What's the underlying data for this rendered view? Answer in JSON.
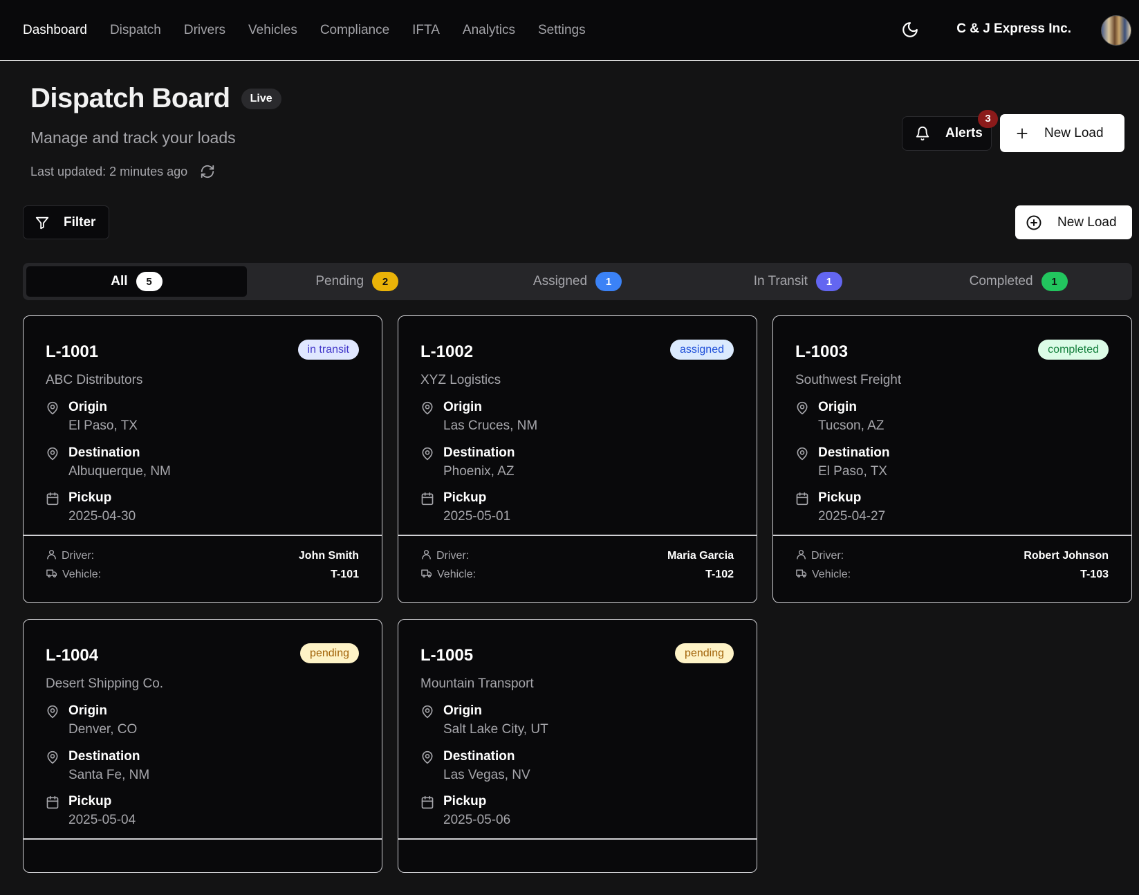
{
  "nav": {
    "items": [
      "Dashboard",
      "Dispatch",
      "Drivers",
      "Vehicles",
      "Compliance",
      "IFTA",
      "Analytics",
      "Settings"
    ],
    "company": "C & J Express Inc."
  },
  "header": {
    "title": "Dispatch Board",
    "badge": "Live",
    "subtitle": "Manage and track your loads",
    "last_updated": "Last updated: 2 minutes ago",
    "alerts_label": "Alerts",
    "alerts_count": "3",
    "new_load_label": "New Load"
  },
  "toolbar": {
    "filter_label": "Filter",
    "new_load_label": "New Load"
  },
  "tabs": [
    {
      "label": "All",
      "count": "5",
      "badge_bg": "#ffffff",
      "badge_fg": "#111111"
    },
    {
      "label": "Pending",
      "count": "2",
      "badge_bg": "#eab308",
      "badge_fg": "#111111"
    },
    {
      "label": "Assigned",
      "count": "1",
      "badge_bg": "#3b82f6",
      "badge_fg": "#ffffff"
    },
    {
      "label": "In Transit",
      "count": "1",
      "badge_bg": "#6366f1",
      "badge_fg": "#ffffff"
    },
    {
      "label": "Completed",
      "count": "1",
      "badge_bg": "#22c55e",
      "badge_fg": "#111111"
    }
  ],
  "labels": {
    "origin": "Origin",
    "destination": "Destination",
    "pickup": "Pickup",
    "driver": "Driver:",
    "vehicle": "Vehicle:"
  },
  "loads": [
    {
      "id": "L-1001",
      "status": "in transit",
      "status_bg": "#e0e7ff",
      "status_fg": "#4338ca",
      "customer": "ABC Distributors",
      "origin": "El Paso, TX",
      "destination": "Albuquerque, NM",
      "pickup": "2025-04-30",
      "driver": "John Smith",
      "vehicle": "T-101"
    },
    {
      "id": "L-1002",
      "status": "assigned",
      "status_bg": "#dbeafe",
      "status_fg": "#1d4ed8",
      "customer": "XYZ Logistics",
      "origin": "Las Cruces, NM",
      "destination": "Phoenix, AZ",
      "pickup": "2025-05-01",
      "driver": "Maria Garcia",
      "vehicle": "T-102"
    },
    {
      "id": "L-1003",
      "status": "completed",
      "status_bg": "#dcfce7",
      "status_fg": "#15803d",
      "customer": "Southwest Freight",
      "origin": "Tucson, AZ",
      "destination": "El Paso, TX",
      "pickup": "2025-04-27",
      "driver": "Robert Johnson",
      "vehicle": "T-103"
    },
    {
      "id": "L-1004",
      "status": "pending",
      "status_bg": "#fef3c7",
      "status_fg": "#a16207",
      "customer": "Desert Shipping Co.",
      "origin": "Denver, CO",
      "destination": "Santa Fe, NM",
      "pickup": "2025-05-04"
    },
    {
      "id": "L-1005",
      "status": "pending",
      "status_bg": "#fef3c7",
      "status_fg": "#a16207",
      "customer": "Mountain Transport",
      "origin": "Salt Lake City, UT",
      "destination": "Las Vegas, NV",
      "pickup": "2025-05-06"
    }
  ]
}
